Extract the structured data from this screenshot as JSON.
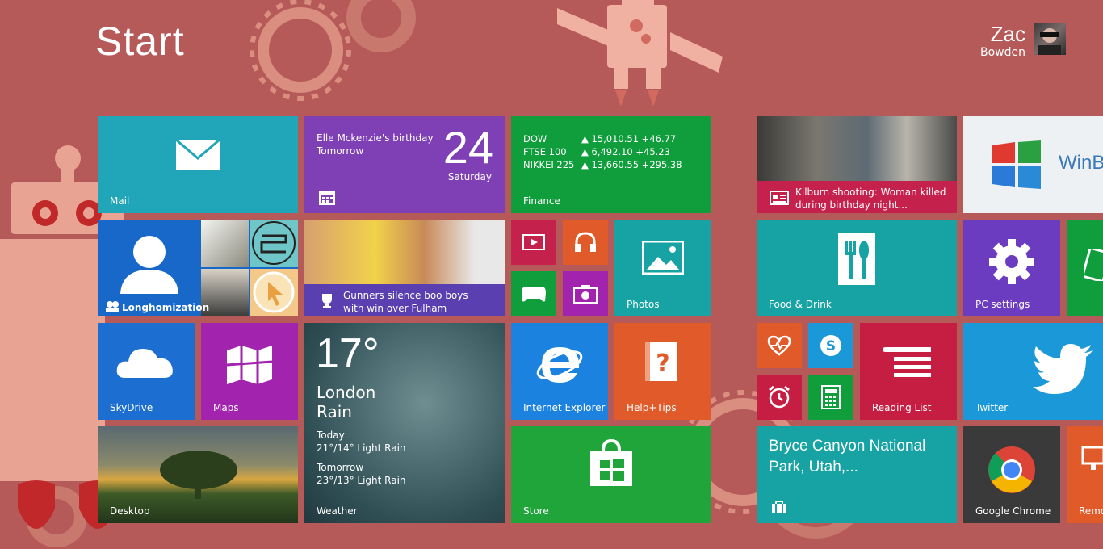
{
  "start": {
    "title": "Start"
  },
  "user": {
    "first_name": "Zac",
    "last_name": "Bowden"
  },
  "tiles": {
    "mail": {
      "label": "Mail"
    },
    "calendar": {
      "event": "Elle Mckenzie's birthday",
      "when": "Tomorrow",
      "day_number": "24",
      "day_name": "Saturday"
    },
    "finance": {
      "label": "Finance",
      "rows": [
        {
          "name": "DOW",
          "value": "▲ 15,010.51 +46.77"
        },
        {
          "name": "FTSE 100",
          "value": "▲ 6,492.10 +45.23"
        },
        {
          "name": "NIKKEI 225",
          "value": "▲ 13,660.55 +295.38"
        }
      ]
    },
    "news": {
      "headline": "Kilburn shooting: Woman killed during birthday night..."
    },
    "winblog": {
      "text": "WinB"
    },
    "people": {
      "label": "Longhomization"
    },
    "sport": {
      "headline": "Gunners silence boo boys with win over Fulham"
    },
    "photos": {
      "label": "Photos"
    },
    "food": {
      "label": "Food & Drink"
    },
    "pcsettings": {
      "label": "PC settings"
    },
    "skydrive": {
      "label": "SkyDrive"
    },
    "maps": {
      "label": "Maps"
    },
    "weather": {
      "label": "Weather",
      "temp": "17°",
      "city": "London",
      "condition": "Rain",
      "today_label": "Today",
      "today": "21°/14° Light Rain",
      "tomorrow_label": "Tomorrow",
      "tomorrow": "23°/13° Light Rain"
    },
    "ie": {
      "label": "Internet Explorer"
    },
    "help": {
      "label": "Help+Tips"
    },
    "reading": {
      "label": "Reading List"
    },
    "twitter": {
      "label": "Twitter"
    },
    "desktop": {
      "label": "Desktop"
    },
    "store": {
      "label": "Store"
    },
    "travel": {
      "headline": "Bryce Canyon National Park, Utah,..."
    },
    "chrome": {
      "label": "Google Chrome"
    },
    "remote": {
      "label": "Remo"
    }
  },
  "colors": {
    "background": "#b55a58",
    "mail": "#21a5b8",
    "calendar": "#7f3fb5",
    "finance": "#109d3b",
    "news": "#c4224d",
    "people": "#1868c9",
    "sport": "#5a3fb0",
    "teal": "#17a3a3",
    "pcsettings": "#6c3cc0",
    "skydrive": "#1c6fd0",
    "maps": "#a223ad",
    "ie": "#1b82e0",
    "help": "#e05a2a",
    "reading": "#c61e42",
    "twitter": "#1b98d8",
    "store": "#20a53b",
    "chrome": "#3a3a3a"
  }
}
